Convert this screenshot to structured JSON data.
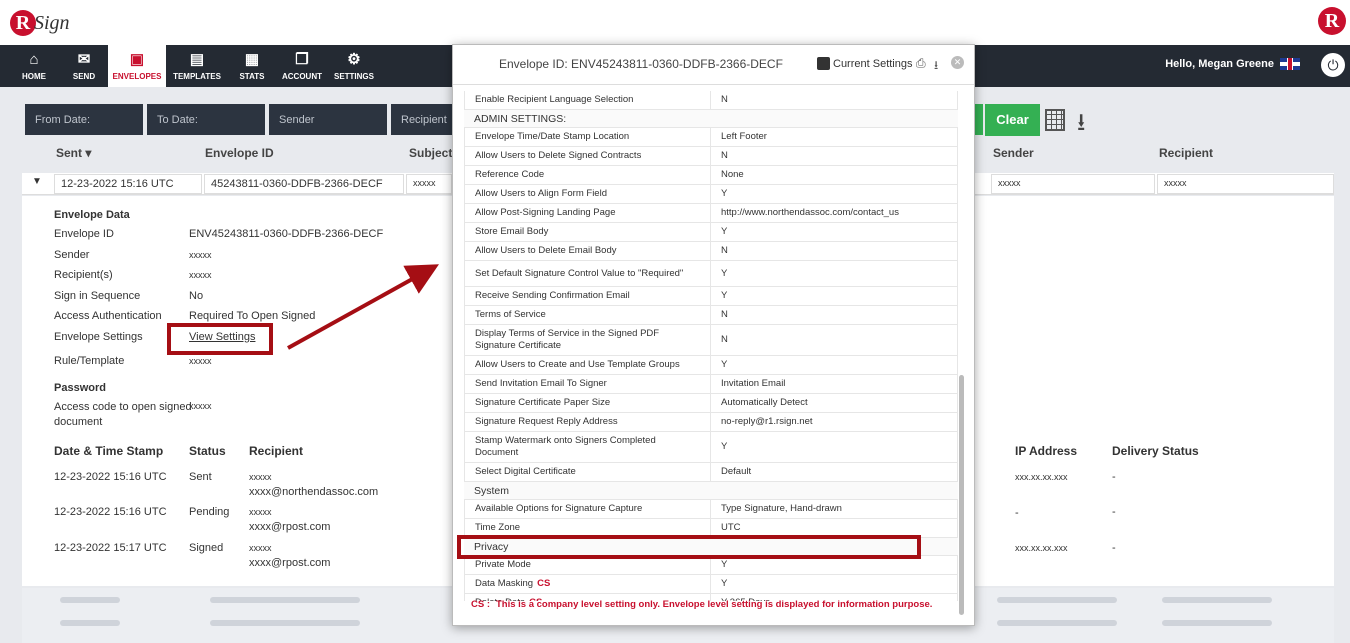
{
  "brand": {
    "logo_letter": "R",
    "logo_word": "Sign"
  },
  "nav": [
    {
      "label": "HOME",
      "icon": "⌂"
    },
    {
      "label": "SEND",
      "icon": "✉"
    },
    {
      "label": "ENVELOPES",
      "icon": "▣"
    },
    {
      "label": "TEMPLATES",
      "icon": "▤"
    },
    {
      "label": "STATS",
      "icon": "▦"
    },
    {
      "label": "ACCOUNT",
      "icon": "❐"
    },
    {
      "label": "SETTINGS",
      "icon": "⚙"
    }
  ],
  "user": {
    "greeting": "Hello, Megan Greene"
  },
  "filters": {
    "from_date": "From Date:",
    "to_date": "To Date:",
    "sender": "Sender",
    "recipient": "Recipient",
    "clear": "Clear"
  },
  "table": {
    "headers": {
      "sent": "Sent",
      "envelope_id": "Envelope ID",
      "subject": "Subject",
      "sender": "Sender",
      "recipient": "Recipient"
    },
    "row": {
      "sent": "12-23-2022 15:16 UTC",
      "envelope_id": "45243811-0360-DDFB-2366-DECF",
      "subject": "xxxxx",
      "sender": "xxxxx",
      "recipient": "xxxxx"
    }
  },
  "details": {
    "envelope_data_title": "Envelope Data",
    "envelope_id_label": "Envelope ID",
    "envelope_id": "ENV45243811-0360-DDFB-2366-DECF",
    "sender_label": "Sender",
    "sender": "xxxxx",
    "recipients_label": "Recipient(s)",
    "recipients": "xxxxx",
    "sign_seq_label": "Sign in Sequence",
    "sign_seq": "No",
    "access_auth_label": "Access Authentication",
    "access_auth": "Required To Open Signed",
    "env_settings_label": "Envelope Settings",
    "view_settings": "View Settings",
    "rule_label": "Rule/Template",
    "rule": "xxxxx",
    "password_title": "Password",
    "access_code_label_1": "Access code to open signed",
    "access_code_label_2": "document",
    "access_code": "xxxxx"
  },
  "history": {
    "headers": {
      "date": "Date & Time Stamp",
      "status": "Status",
      "recipient": "Recipient",
      "ip": "IP Address",
      "delivery": "Delivery Status"
    },
    "rows": [
      {
        "date": "12-23-2022 15:16 UTC",
        "status": "Sent",
        "name": "xxxxx",
        "email": "xxxx@northendassoc.com",
        "ip": "xxx.xx.xx.xxx",
        "delivery": "-"
      },
      {
        "date": "12-23-2022 15:16 UTC",
        "status": "Pending",
        "name": "xxxxx",
        "email": "xxxx@rpost.com",
        "ip": "-",
        "delivery": "-"
      },
      {
        "date": "12-23-2022 15:17 UTC",
        "status": "Signed",
        "name": "xxxxx",
        "email": "xxxx@rpost.com",
        "ip": "xxx.xx.xx.xxx",
        "delivery": "-"
      }
    ]
  },
  "modal": {
    "title": "Envelope ID: ENV45243811-0360-DDFB-2366-DECF",
    "current_settings": "Current Settings",
    "top_row": {
      "k": "Enable Recipient Language Selection",
      "v": "N"
    },
    "admin_title": "ADMIN SETTINGS:",
    "admin": [
      {
        "k": "Envelope Time/Date Stamp Location",
        "v": "Left Footer"
      },
      {
        "k": "Allow Users to Delete Signed Contracts",
        "v": "N"
      },
      {
        "k": "Reference Code",
        "v": "None"
      },
      {
        "k": "Allow Users to Align Form Field",
        "v": "Y"
      },
      {
        "k": "Allow Post-Signing Landing Page",
        "v": "http://www.northendassoc.com/contact_us"
      },
      {
        "k": "Store Email Body",
        "v": "Y"
      },
      {
        "k": "Allow Users to Delete Email Body",
        "v": "N"
      },
      {
        "k": "Set Default Signature Control Value to \"Required\"",
        "v": "Y"
      },
      {
        "k": "Receive Sending Confirmation Email",
        "v": "Y"
      },
      {
        "k": "Terms of Service",
        "v": "N"
      },
      {
        "k": "Display Terms of Service in the Signed PDF Signature Certificate",
        "v": "N"
      },
      {
        "k": "Allow Users to Create and Use Template Groups",
        "v": "Y"
      },
      {
        "k": "Send Invitation Email To Signer",
        "v": "Invitation Email"
      },
      {
        "k": "Signature Certificate Paper Size",
        "v": "Automatically Detect"
      },
      {
        "k": "Signature Request Reply Address",
        "v": "no-reply@r1.rsign.net"
      },
      {
        "k": "Stamp Watermark onto Signers Completed Document",
        "v": "Y"
      },
      {
        "k": "Select Digital Certificate",
        "v": "Default"
      }
    ],
    "system_title": "System",
    "system": [
      {
        "k": "Available Options for Signature Capture",
        "v": "Type Signature, Hand-drawn"
      },
      {
        "k": "Time Zone",
        "v": "UTC"
      }
    ],
    "privacy_title": "Privacy",
    "privacy": [
      {
        "k": "Private Mode",
        "v": "Y",
        "cs": ""
      },
      {
        "k": "Data Masking",
        "v": "Y",
        "cs": "CS"
      },
      {
        "k": "Delete Data",
        "v": "Y 365 Days",
        "cs": "CS"
      }
    ],
    "note_cs": "CS :",
    "note_text": "This is a company level setting only. Envelope level setting is displayed for information purpose."
  }
}
